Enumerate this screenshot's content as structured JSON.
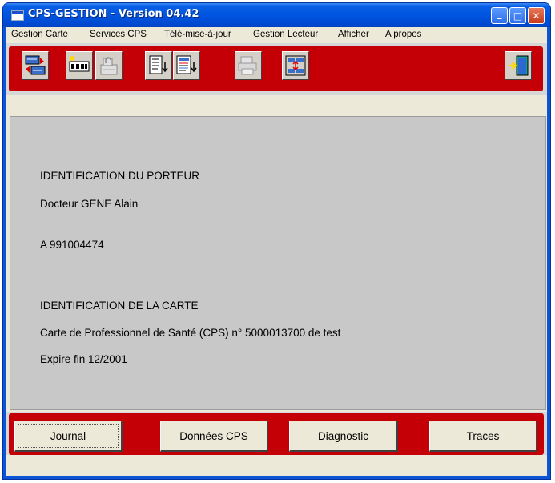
{
  "window": {
    "title": "CPS-GESTION - Version 04.42",
    "controls": {
      "minimize": "_",
      "maximize": "□",
      "close": "✕"
    }
  },
  "menu": [
    {
      "label": "Gestion Carte"
    },
    {
      "label": "Services CPS"
    },
    {
      "label": "Télé-mise-à-jour"
    },
    {
      "label": "Gestion Lecteur"
    },
    {
      "label": "Afficher"
    },
    {
      "label": "A propos"
    }
  ],
  "toolbar": {
    "icons": [
      "card-transfer-icon",
      "card-reader-icon",
      "card-unlock-icon",
      "document-list-icon",
      "document-detail-icon",
      "printer-icon",
      "card-sync-icon",
      "exit-door-icon"
    ]
  },
  "porteur": {
    "heading": "IDENTIFICATION DU PORTEUR",
    "name": "Docteur GENE Alain",
    "id": "A 991004474"
  },
  "carte": {
    "heading": "IDENTIFICATION DE LA CARTE",
    "description": "Carte de Professionnel de Santé (CPS) n° 5000013700 de test",
    "expiry": "Expire fin 12/2001"
  },
  "buttons": {
    "journal_mn": "J",
    "journal_rest": "ournal",
    "donnees_mn": "D",
    "donnees_rest": "onnées CPS",
    "diag_pre": "Dia",
    "diag_mn": "g",
    "diag_post": "nostic",
    "traces_mn": "T",
    "traces_rest": "races"
  },
  "colors": {
    "titlebar": "#0055e0",
    "toolbar_band": "#c40006",
    "content_bg": "#c8c8c8"
  }
}
